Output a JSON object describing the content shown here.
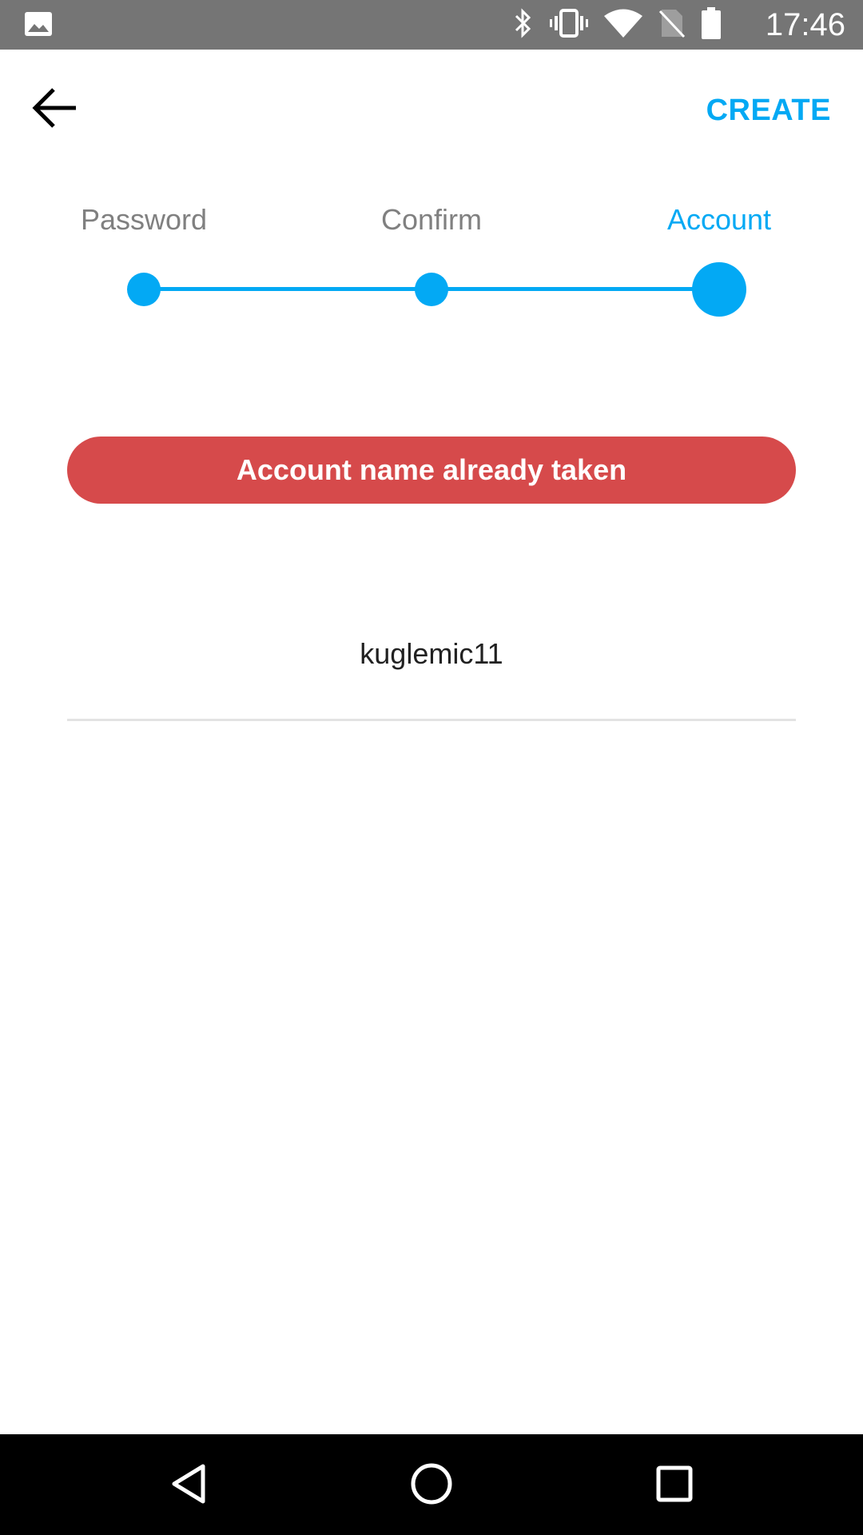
{
  "status_bar": {
    "time": "17:46",
    "icons": [
      "gallery-icon",
      "bluetooth-icon",
      "vibrate-icon",
      "wifi-icon",
      "no-sim-icon",
      "battery-icon"
    ]
  },
  "header": {
    "back_icon": "arrow-back-icon",
    "create_label": "CREATE"
  },
  "stepper": {
    "steps": [
      {
        "label": "Password",
        "active": false
      },
      {
        "label": "Confirm",
        "active": false
      },
      {
        "label": "Account",
        "active": true
      }
    ]
  },
  "error": {
    "message": "Account name already taken"
  },
  "account_input": {
    "value": "kuglemic11"
  },
  "nav_bar": {
    "icons": [
      "nav-back-icon",
      "nav-home-icon",
      "nav-recents-icon"
    ]
  },
  "colors": {
    "accent": "#03a9f4",
    "error": "#d64a4b",
    "status_bar": "#757575",
    "nav_bar": "#000000"
  }
}
